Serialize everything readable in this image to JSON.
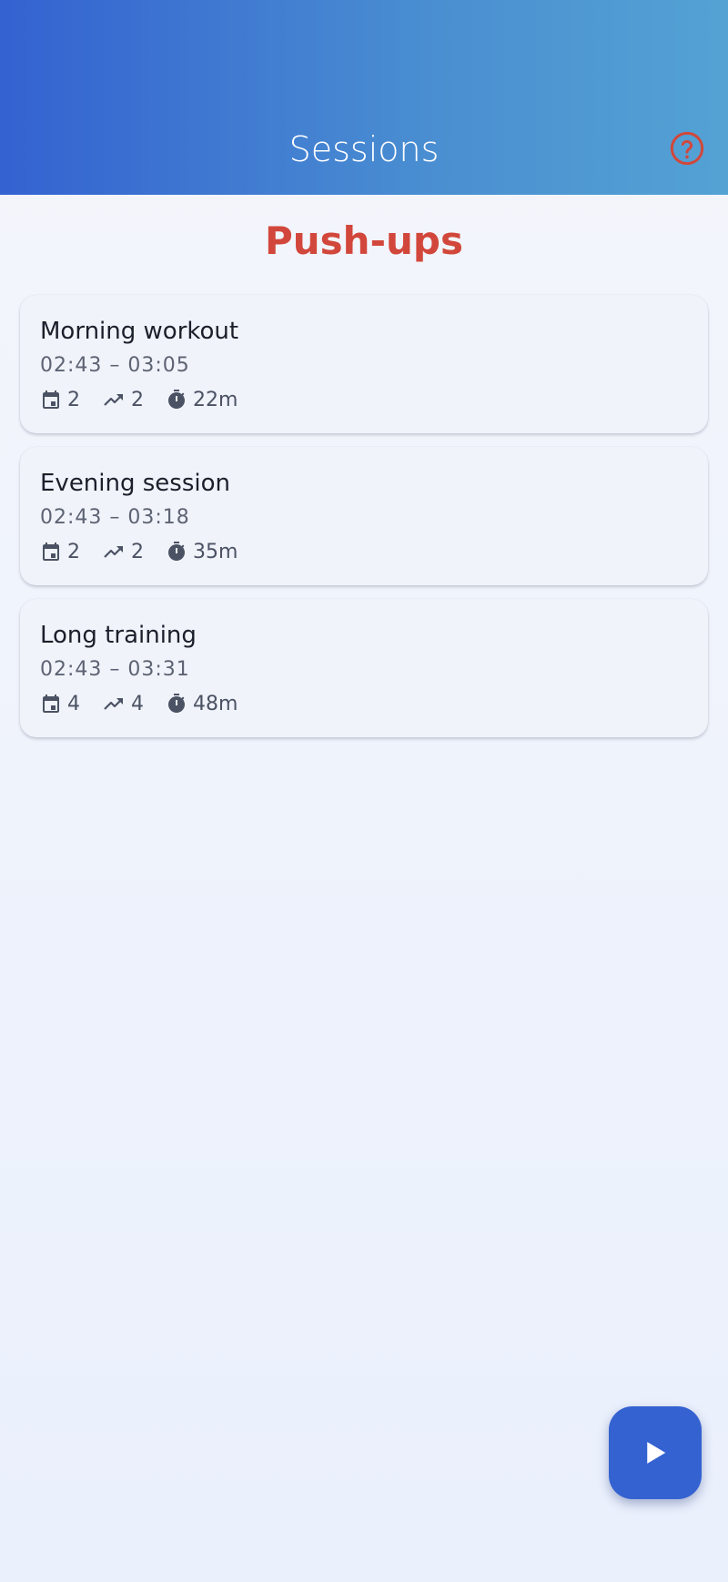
{
  "header": {
    "title": "Sessions",
    "help_icon": "help-circle-icon",
    "help_color": "#d2473b",
    "gradient_start": "#3462d1",
    "gradient_end": "#54a2d4"
  },
  "exercise": {
    "title": "Push-ups",
    "color": "#d2473b"
  },
  "sessions": [
    {
      "name": "Morning workout",
      "range": "02:43 – 03:05",
      "days": "2",
      "trend": "2",
      "duration": "22m"
    },
    {
      "name": "Evening session",
      "range": "02:43 – 03:18",
      "days": "2",
      "trend": "2",
      "duration": "35m"
    },
    {
      "name": "Long training",
      "range": "02:43 – 03:31",
      "days": "4",
      "trend": "4",
      "duration": "48m"
    }
  ],
  "icons": {
    "days": "calendar-icon",
    "trend": "trending-up-icon",
    "duration": "timer-icon",
    "fab": "play-icon"
  },
  "fab": {
    "color": "#3462d1"
  }
}
